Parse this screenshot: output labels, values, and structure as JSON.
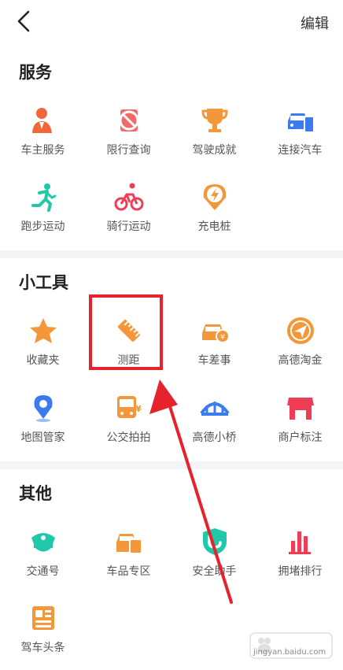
{
  "header": {
    "edit_label": "编辑"
  },
  "sections": [
    {
      "title": "服务",
      "items": [
        {
          "label": "车主服务",
          "icon": "car-owner-icon"
        },
        {
          "label": "限行查询",
          "icon": "restriction-icon"
        },
        {
          "label": "驾驶成就",
          "icon": "trophy-icon"
        },
        {
          "label": "连接汽车",
          "icon": "car-connect-icon"
        },
        {
          "label": "跑步运动",
          "icon": "running-icon"
        },
        {
          "label": "骑行运动",
          "icon": "cycling-icon"
        },
        {
          "label": "充电桩",
          "icon": "charging-icon"
        }
      ]
    },
    {
      "title": "小工具",
      "items": [
        {
          "label": "收藏夹",
          "icon": "star-icon"
        },
        {
          "label": "测距",
          "icon": "ruler-icon"
        },
        {
          "label": "车差事",
          "icon": "car-errand-icon"
        },
        {
          "label": "高德淘金",
          "icon": "paper-plane-icon"
        },
        {
          "label": "地图管家",
          "icon": "map-pin-icon"
        },
        {
          "label": "公交拍拍",
          "icon": "bus-icon"
        },
        {
          "label": "高德小桥",
          "icon": "bridge-icon"
        },
        {
          "label": "商户标注",
          "icon": "shop-icon"
        }
      ]
    },
    {
      "title": "其他",
      "items": [
        {
          "label": "交通号",
          "icon": "police-cap-icon"
        },
        {
          "label": "车品专区",
          "icon": "car-goods-icon"
        },
        {
          "label": "安全助手",
          "icon": "shield-icon"
        },
        {
          "label": "拥堵排行",
          "icon": "bar-chart-icon"
        },
        {
          "label": "驾车头条",
          "icon": "news-icon"
        }
      ]
    }
  ],
  "watermark": {
    "text": "jingyan.baidu.com"
  },
  "colors": {
    "accent_red": "#e6232d",
    "orange": "#f4963a",
    "blue": "#3a7bf0",
    "green": "#1fc8a8"
  }
}
